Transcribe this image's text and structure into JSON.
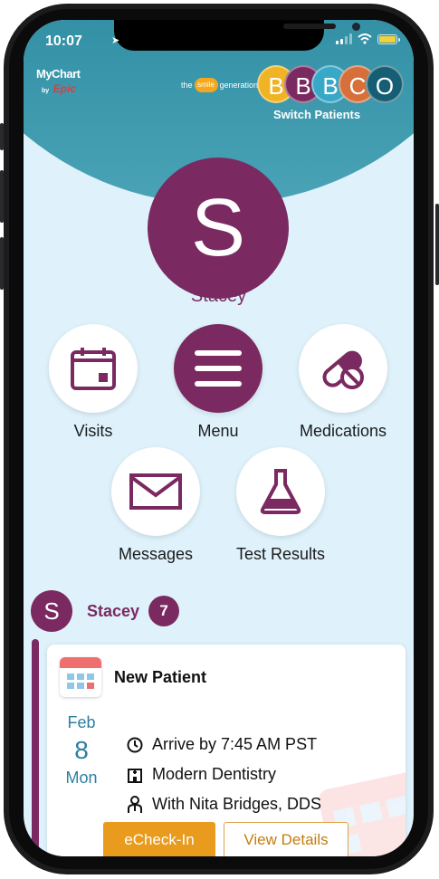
{
  "status_bar": {
    "time": "10:07",
    "location_icon": "location-arrow-icon"
  },
  "branding": {
    "mychart": "MyChart",
    "by": "by",
    "epic": "Epic",
    "practice_brand_left": "the",
    "practice_brand_mid": "smile",
    "practice_brand_right": "generation"
  },
  "patients": {
    "avatars": [
      {
        "letter": "B",
        "color": "#f0b323"
      },
      {
        "letter": "B",
        "color": "#7a2a61"
      },
      {
        "letter": "B",
        "color": "#38a8c8"
      },
      {
        "letter": "C",
        "color": "#d66f3a"
      },
      {
        "letter": "O",
        "color": "#165e73"
      }
    ],
    "switch_label": "Switch Patients"
  },
  "profile": {
    "initial": "S",
    "name": "Stacey",
    "color": "#7a2a61"
  },
  "tiles": [
    {
      "label": "Visits",
      "icon": "calendar-icon"
    },
    {
      "label": "Menu",
      "icon": "menu-icon"
    },
    {
      "label": "Medications",
      "icon": "pill-icon"
    },
    {
      "label": "Messages",
      "icon": "envelope-icon"
    },
    {
      "label": "Test Results",
      "icon": "flask-icon"
    }
  ],
  "feed": {
    "initial": "S",
    "name": "Stacey",
    "count": "7",
    "card": {
      "title": "New Patient",
      "month": "Feb",
      "day": "8",
      "weekday": "Mon",
      "arrive": "Arrive by 7:45 AM PST",
      "location": "Modern Dentistry",
      "provider": "With Nita Bridges, DDS",
      "primary_button": "eCheck-In",
      "secondary_button": "View Details"
    }
  },
  "colors": {
    "brand_plum": "#7a2a61",
    "header_teal": "#0e5872",
    "screen_bg": "#dff2fb",
    "accent_orange": "#e89b1c"
  }
}
